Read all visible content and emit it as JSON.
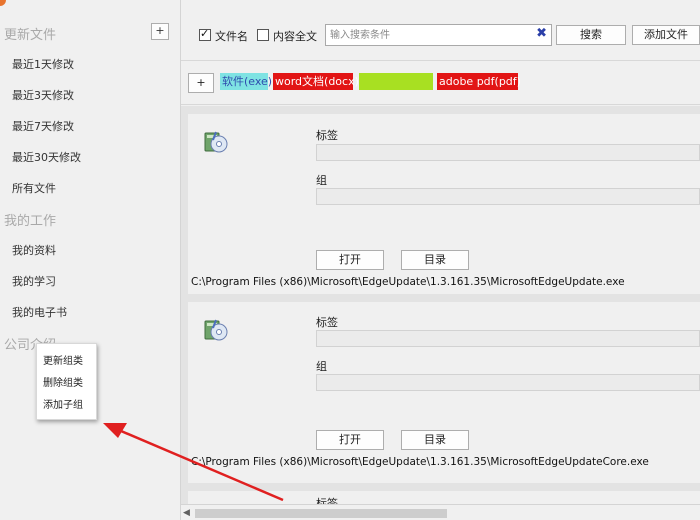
{
  "sidebar": {
    "add_button": "+",
    "groups": [
      {
        "title": "更新文件",
        "items": [
          "最近1天修改",
          "最近3天修改",
          "最近7天修改",
          "最近30天修改",
          "所有文件"
        ]
      },
      {
        "title": "我的工作",
        "items": [
          "我的资料",
          "我的学习",
          "我的电子书"
        ]
      },
      {
        "title": "公司介绍",
        "items": []
      }
    ]
  },
  "context_menu": {
    "items": [
      "更新组类",
      "删除组类",
      "添加子组"
    ]
  },
  "toolbar": {
    "filename_label": "文件名",
    "filename_checked": true,
    "content_label": "内容全文",
    "content_checked": false,
    "search_placeholder": "输入搜索条件",
    "clear_glyph": "✖",
    "search_button": "搜索",
    "add_file_button": "添加文件"
  },
  "tagbar": {
    "add_button": "+",
    "tags": [
      {
        "label": "软件(exe)",
        "bg": "#7fe3e3",
        "fg": "#2e4cae"
      },
      {
        "label": "word文档(docx)",
        "bg": "#e21515",
        "fg": "#ffffff"
      },
      {
        "label": "",
        "bg": "#a8e022",
        "fg": "#a8e022"
      },
      {
        "label": "adobe pdf(pdf)",
        "bg": "#e21515",
        "fg": "#ffffff"
      }
    ]
  },
  "cards": [
    {
      "tag_label": "标签",
      "group_label": "组",
      "open_button": "打开",
      "dir_button": "目录",
      "path": "C:\\Program Files (x86)\\Microsoft\\EdgeUpdate\\1.3.161.35\\MicrosoftEdgeUpdate.exe"
    },
    {
      "tag_label": "标签",
      "group_label": "组",
      "open_button": "打开",
      "dir_button": "目录",
      "path": "C:\\Program Files (x86)\\Microsoft\\EdgeUpdate\\1.3.161.35\\MicrosoftEdgeUpdateCore.exe"
    },
    {
      "tag_label": "标签"
    }
  ],
  "scrollbar": {
    "left_arrow": "◀"
  },
  "colors": {
    "annotation_arrow": "#e02020",
    "app_logo": "#e8742e"
  }
}
